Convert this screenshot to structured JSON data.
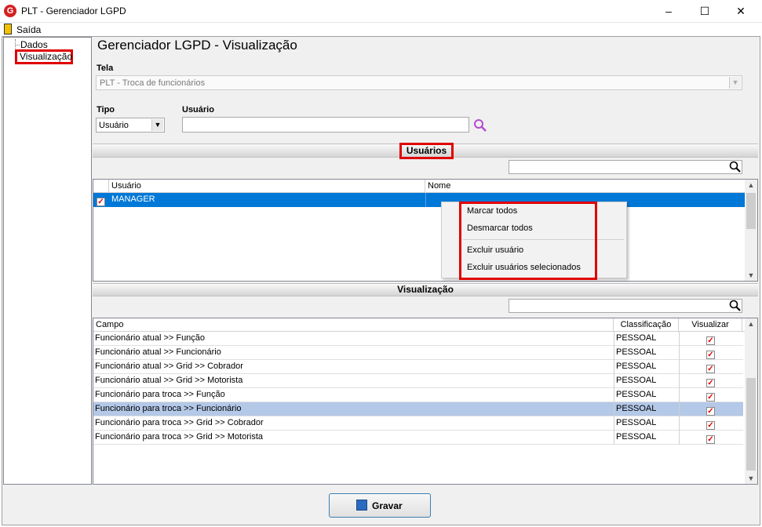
{
  "window": {
    "title": "PLT - Gerenciador LGPD",
    "logo_letter": "G"
  },
  "menu": {
    "exit_label": "Saída"
  },
  "tree": {
    "items": [
      "Dados",
      "Visualização"
    ]
  },
  "page": {
    "title": "Gerenciador LGPD - Visualização"
  },
  "form": {
    "tela_label": "Tela",
    "tela_value": "PLT - Troca de funcionários",
    "tipo_label": "Tipo",
    "tipo_value": "Usuário",
    "usuario_label": "Usuário",
    "usuario_value": ""
  },
  "users_section": {
    "title": "Usuários",
    "search_value": "",
    "columns": [
      "Usuário",
      "Nome"
    ],
    "rows": [
      {
        "checked": true,
        "usuario": "MANAGER",
        "nome": ""
      }
    ]
  },
  "context_menu": {
    "items": [
      "Marcar todos",
      "Desmarcar todos",
      "Excluir usuário",
      "Excluir usuários selecionados"
    ]
  },
  "view_section": {
    "title": "Visualização",
    "search_value": "",
    "columns": [
      "Campo",
      "Classificação",
      "Visualizar"
    ],
    "rows": [
      {
        "campo": "Funcionário atual >> Função",
        "classificacao": "PESSOAL",
        "visualizar": true
      },
      {
        "campo": "Funcionário atual >> Funcionário",
        "classificacao": "PESSOAL",
        "visualizar": true
      },
      {
        "campo": "Funcionário atual >> Grid >> Cobrador",
        "classificacao": "PESSOAL",
        "visualizar": true
      },
      {
        "campo": "Funcionário atual >> Grid >> Motorista",
        "classificacao": "PESSOAL",
        "visualizar": true
      },
      {
        "campo": "Funcionário para troca >> Função",
        "classificacao": "PESSOAL",
        "visualizar": true
      },
      {
        "campo": "Funcionário para troca >> Funcionário",
        "classificacao": "PESSOAL",
        "visualizar": true,
        "selected": true
      },
      {
        "campo": "Funcionário para troca >> Grid >> Cobrador",
        "classificacao": "PESSOAL",
        "visualizar": true
      },
      {
        "campo": "Funcionário para troca >> Grid >> Motorista",
        "classificacao": "PESSOAL",
        "visualizar": true
      }
    ]
  },
  "footer": {
    "save_label": "Gravar"
  },
  "colors": {
    "selection": "#0078d7",
    "row_selection": "#b4c8e8",
    "highlight": "#e00000"
  }
}
